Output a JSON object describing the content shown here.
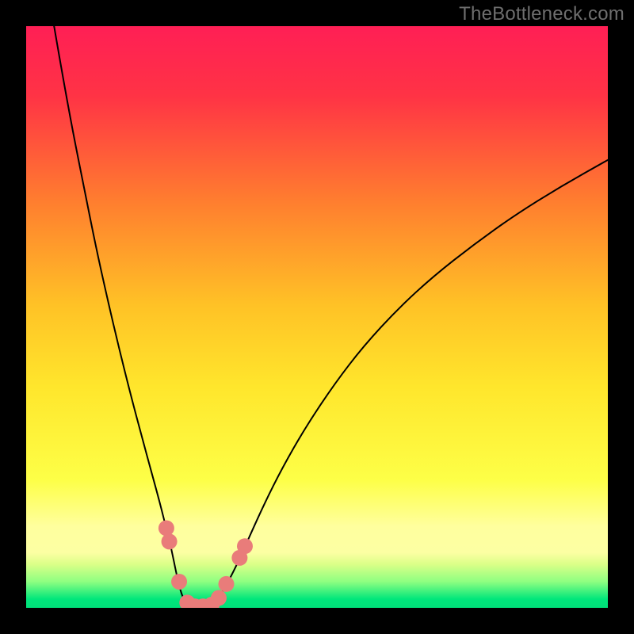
{
  "watermark": "TheBottleneck.com",
  "chart_data": {
    "type": "line",
    "title": "",
    "xlabel": "",
    "ylabel": "",
    "xlim": [
      0,
      100
    ],
    "ylim": [
      0,
      100
    ],
    "grid": false,
    "legend": false,
    "background": {
      "type": "vertical-gradient",
      "stops": [
        {
          "offset": 0.0,
          "color": "#ff1f55"
        },
        {
          "offset": 0.12,
          "color": "#ff3345"
        },
        {
          "offset": 0.3,
          "color": "#ff7d2f"
        },
        {
          "offset": 0.48,
          "color": "#ffc226"
        },
        {
          "offset": 0.62,
          "color": "#ffe62c"
        },
        {
          "offset": 0.78,
          "color": "#fdff47"
        },
        {
          "offset": 0.86,
          "color": "#ffff9e"
        },
        {
          "offset": 0.905,
          "color": "#fcffa3"
        },
        {
          "offset": 0.925,
          "color": "#dbff88"
        },
        {
          "offset": 0.955,
          "color": "#8eff81"
        },
        {
          "offset": 0.985,
          "color": "#00e67b"
        },
        {
          "offset": 1.0,
          "color": "#00e07a"
        }
      ]
    },
    "series": [
      {
        "name": "bottleneck-curve-left",
        "stroke": "#000000",
        "strokeWidth": 2,
        "points": [
          {
            "x": 4.8,
            "y": 100.0
          },
          {
            "x": 6.0,
            "y": 93.0
          },
          {
            "x": 8.0,
            "y": 82.0
          },
          {
            "x": 10.0,
            "y": 72.0
          },
          {
            "x": 12.0,
            "y": 62.0
          },
          {
            "x": 14.0,
            "y": 53.0
          },
          {
            "x": 16.0,
            "y": 44.5
          },
          {
            "x": 18.0,
            "y": 36.5
          },
          {
            "x": 20.0,
            "y": 29.0
          },
          {
            "x": 21.5,
            "y": 23.5
          },
          {
            "x": 23.0,
            "y": 18.0
          },
          {
            "x": 24.0,
            "y": 14.0
          },
          {
            "x": 25.0,
            "y": 10.0
          },
          {
            "x": 25.8,
            "y": 6.0
          },
          {
            "x": 26.5,
            "y": 3.0
          },
          {
            "x": 27.2,
            "y": 1.2
          },
          {
            "x": 28.0,
            "y": 0.4
          },
          {
            "x": 29.0,
            "y": 0.1
          }
        ]
      },
      {
        "name": "bottleneck-curve-right",
        "stroke": "#000000",
        "strokeWidth": 2,
        "points": [
          {
            "x": 29.0,
            "y": 0.1
          },
          {
            "x": 30.0,
            "y": 0.1
          },
          {
            "x": 31.0,
            "y": 0.2
          },
          {
            "x": 32.0,
            "y": 0.6
          },
          {
            "x": 33.0,
            "y": 1.6
          },
          {
            "x": 34.0,
            "y": 3.2
          },
          {
            "x": 35.0,
            "y": 5.0
          },
          {
            "x": 36.5,
            "y": 8.0
          },
          {
            "x": 38.5,
            "y": 12.5
          },
          {
            "x": 41.0,
            "y": 18.0
          },
          {
            "x": 44.0,
            "y": 24.0
          },
          {
            "x": 48.0,
            "y": 31.0
          },
          {
            "x": 53.0,
            "y": 38.5
          },
          {
            "x": 58.0,
            "y": 45.0
          },
          {
            "x": 64.0,
            "y": 51.5
          },
          {
            "x": 70.0,
            "y": 57.0
          },
          {
            "x": 77.0,
            "y": 62.5
          },
          {
            "x": 84.0,
            "y": 67.5
          },
          {
            "x": 92.0,
            "y": 72.5
          },
          {
            "x": 100.0,
            "y": 77.0
          }
        ]
      },
      {
        "name": "highlight-dots",
        "type": "scatter",
        "fill": "#e97c7a",
        "radius": 10,
        "points": [
          {
            "x": 24.1,
            "y": 13.7
          },
          {
            "x": 24.6,
            "y": 11.4
          },
          {
            "x": 26.3,
            "y": 4.5
          },
          {
            "x": 27.7,
            "y": 0.9
          },
          {
            "x": 29.0,
            "y": 0.25
          },
          {
            "x": 30.4,
            "y": 0.25
          },
          {
            "x": 31.9,
            "y": 0.55
          },
          {
            "x": 33.1,
            "y": 1.7
          },
          {
            "x": 34.4,
            "y": 4.1
          },
          {
            "x": 36.7,
            "y": 8.6
          },
          {
            "x": 37.6,
            "y": 10.6
          }
        ]
      }
    ]
  }
}
